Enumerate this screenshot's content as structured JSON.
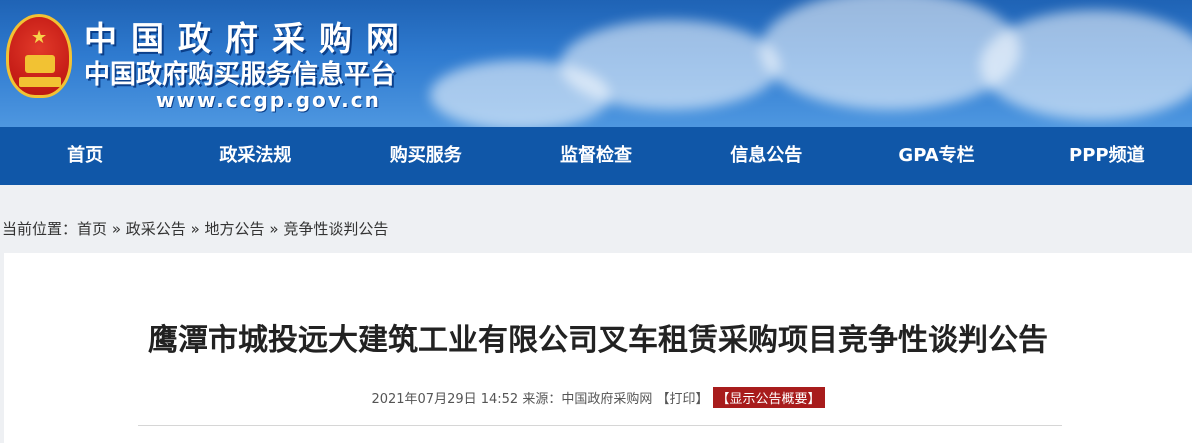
{
  "header": {
    "site_title": "中国政府采购网",
    "site_subtitle": "中国政府购买服务信息平台",
    "site_url": "www.ccgp.gov.cn",
    "emblem_icon": "national-emblem-icon"
  },
  "nav": {
    "items": [
      {
        "label": "首页"
      },
      {
        "label": "政采法规"
      },
      {
        "label": "购买服务"
      },
      {
        "label": "监督检查"
      },
      {
        "label": "信息公告"
      },
      {
        "label": "GPA专栏"
      },
      {
        "label": "PPP频道"
      }
    ]
  },
  "breadcrumb": {
    "prefix": "当前位置：",
    "items": [
      {
        "label": "首页"
      },
      {
        "label": "政采公告"
      },
      {
        "label": "地方公告"
      },
      {
        "label": "竞争性谈判公告"
      }
    ],
    "separator": "»"
  },
  "article": {
    "title": "鹰潭市城投远大建筑工业有限公司叉车租赁采购项目竞争性谈判公告",
    "date": "2021年07月29日 14:52",
    "source_label": "来源：",
    "source": "中国政府采购网",
    "print_label": "【打印】",
    "summary_button": "【显示公告概要】"
  },
  "colors": {
    "nav_bg": "#1057a8",
    "banner_bg": "#2f7bd0",
    "summary_button_bg": "#a81c1c"
  }
}
